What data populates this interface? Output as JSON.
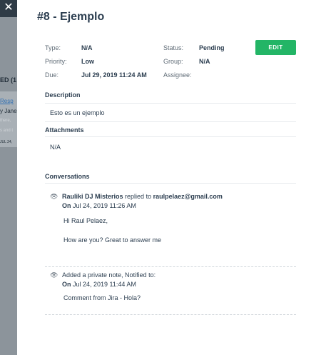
{
  "background": {
    "close": "✕",
    "line1": "ED (1",
    "line2": "Resp",
    "line3": "y Jane",
    "line4": "there,",
    "line5": "s and t",
    "line6": "JUL 24,"
  },
  "ticket": {
    "title": "#8 - Ejemplo",
    "type_label": "Type:",
    "type_value": "N/A",
    "priority_label": "Priority:",
    "priority_value": "Low",
    "due_label": "Due:",
    "due_value": "Jul 29, 2019 11:24 AM",
    "status_label": "Status:",
    "status_value": "Pending",
    "group_label": "Group:",
    "group_value": "N/A",
    "assignee_label": "Assignee:",
    "edit_label": "EDIT"
  },
  "description": {
    "title": "Description",
    "text": "Esto es un ejemplo"
  },
  "attachments": {
    "title": "Attachments",
    "text": "N/A"
  },
  "conversations": {
    "title": "Conversations",
    "items": [
      {
        "author": "Rauliki DJ Misterios",
        "action": "replied to",
        "target": "raulpelaez@gmail.com",
        "on_label": "On",
        "date": "Jul 24, 2019 11:26 AM",
        "line1": "Hi Raul Pelaez,",
        "line2": "How are you? Great to answer me"
      },
      {
        "action": "Added a private note, Notified to:",
        "on_label": "On",
        "date": "Jul 24, 2019 11:44 AM",
        "line1": "Comment from Jira - Hola?"
      }
    ]
  }
}
